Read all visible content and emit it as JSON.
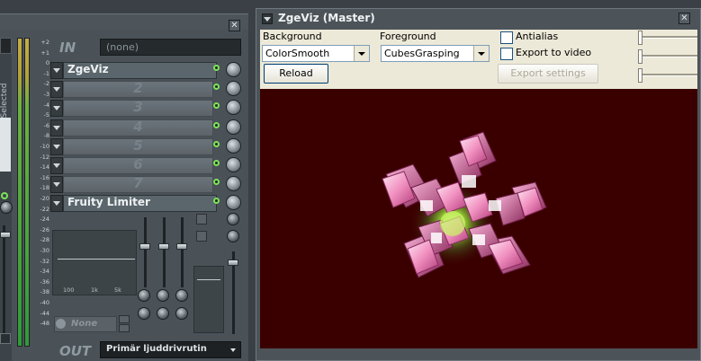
{
  "mixer": {
    "close_label": "✕",
    "selected_label": "Selected",
    "in_label": "IN",
    "in_value": "(none)",
    "out_label": "OUT",
    "out_value": "Primär ljuddrivrutin",
    "db_scale": [
      "+2",
      "+1",
      "0",
      "-1",
      "-2",
      "-3",
      "-4",
      "-5",
      "-6",
      "-8",
      "-10",
      "-12",
      "-14",
      "-16",
      "-18",
      "-20",
      "-22",
      "-24",
      "-26",
      "-28",
      "-30",
      "-32",
      "-34",
      "-36",
      "-38",
      "-40",
      "-44",
      "-48"
    ],
    "slots": [
      {
        "label": "ZgeViz",
        "filled": true
      },
      {
        "label": "2",
        "filled": false
      },
      {
        "label": "3",
        "filled": false
      },
      {
        "label": "4",
        "filled": false
      },
      {
        "label": "5",
        "filled": false
      },
      {
        "label": "6",
        "filled": false
      },
      {
        "label": "7",
        "filled": false
      },
      {
        "label": "Fruity Limiter",
        "filled": true
      }
    ],
    "eq_labels": [
      "100",
      "1k",
      "5k"
    ],
    "preset_label": "None"
  },
  "zgeviz": {
    "title": "ZgeViz (Master)",
    "close_label": "✕",
    "background_label": "Background",
    "background_value": "ColorSmooth",
    "foreground_label": "Foreground",
    "foreground_value": "CubesGrasping",
    "reload_label": "Reload",
    "antialias_label": "Antialias",
    "export_video_label": "Export to video",
    "export_settings_label": "Export settings",
    "viz_background_color": "#3a0000"
  }
}
